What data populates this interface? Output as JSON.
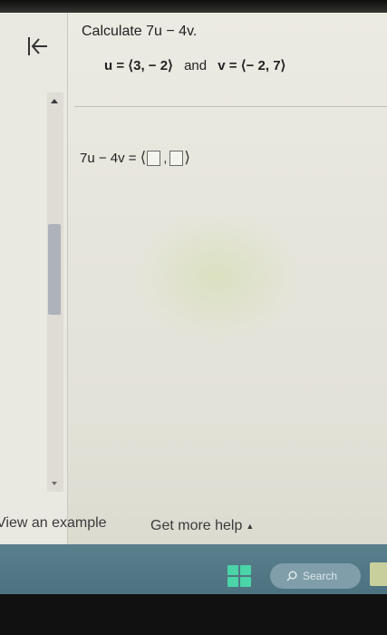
{
  "question": {
    "title": "Calculate 7u − 4v.",
    "vector_u": "u = ⟨3, − 2⟩",
    "and": "and",
    "vector_v": "v = ⟨− 2, 7⟩"
  },
  "answer": {
    "label": "7u − 4v =",
    "open_bracket": "⟨",
    "comma": ",",
    "close_bracket": "⟩"
  },
  "footer": {
    "view_example": "View an example",
    "get_more_help": "Get more help",
    "help_caret": "▲"
  },
  "taskbar": {
    "search_label": "Search"
  },
  "icons": {
    "back": "back-to-start-icon",
    "start": "windows-start-icon",
    "search": "search-icon"
  },
  "colors": {
    "taskbar": "#4c7280",
    "start_icon": "#4bd4a8",
    "scroll_thumb": "#aeb2ba"
  }
}
